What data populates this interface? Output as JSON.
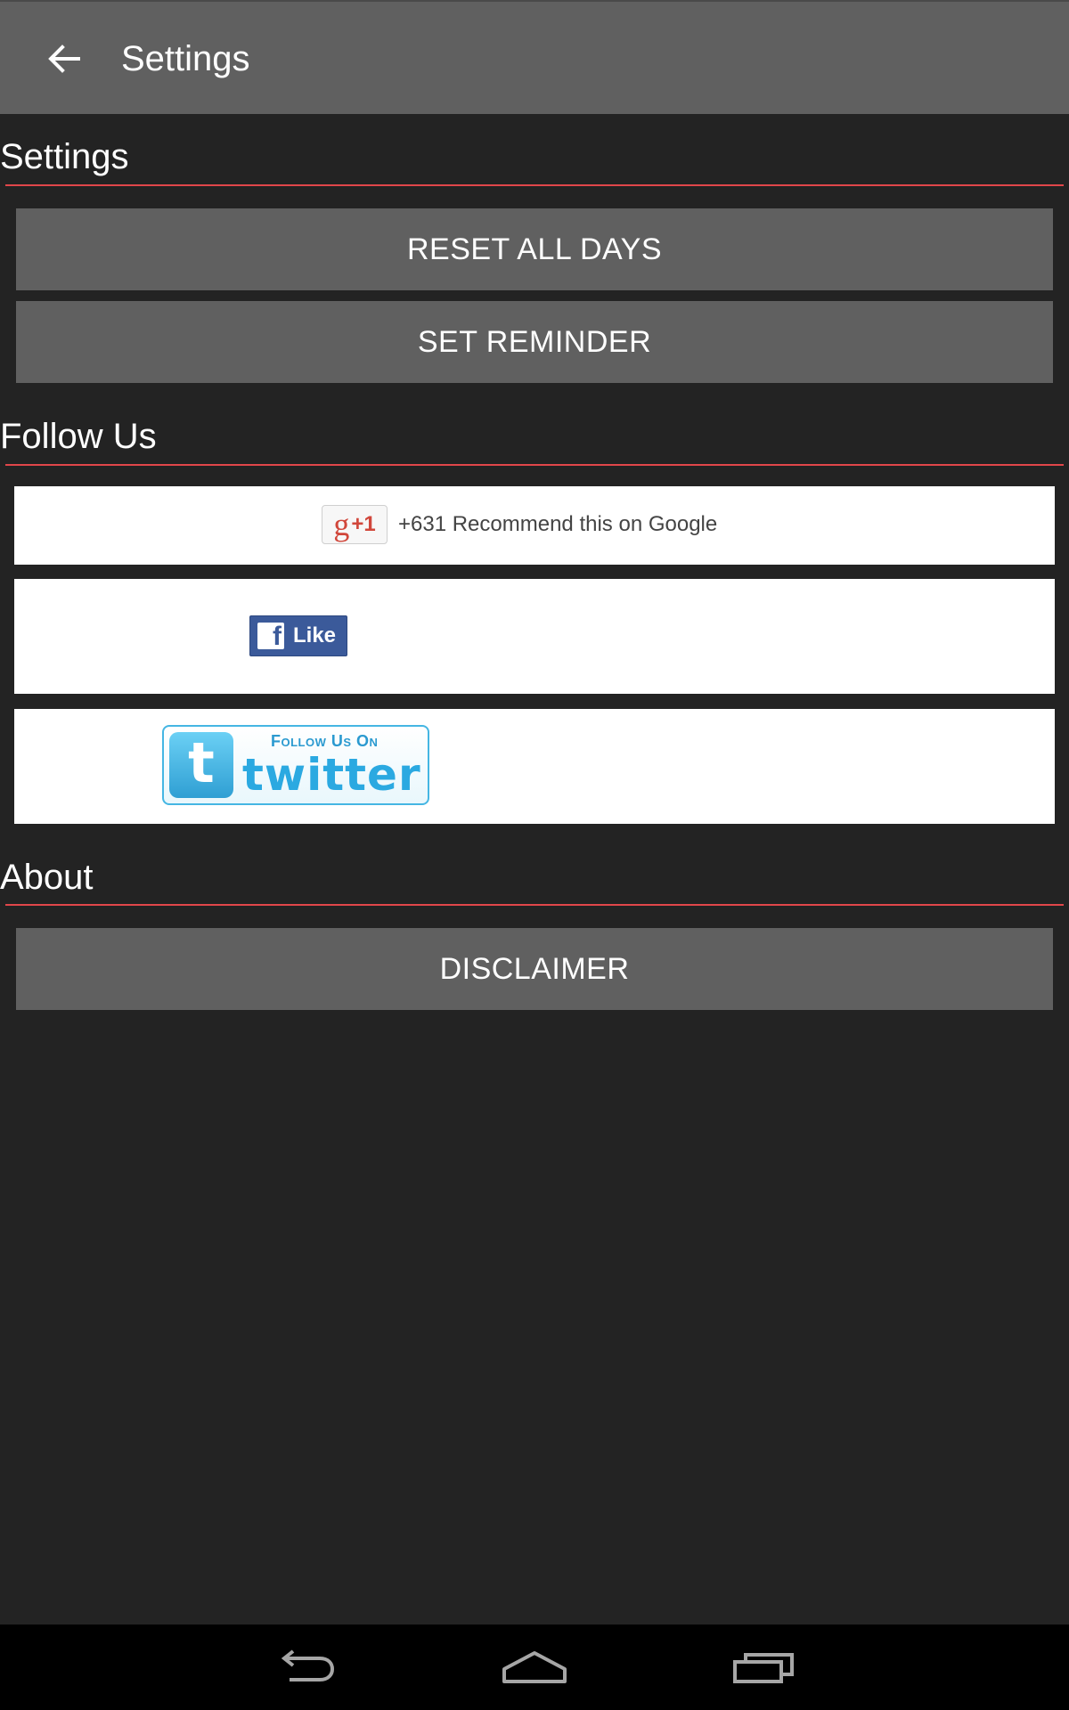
{
  "app_bar": {
    "title": "Settings",
    "back_icon": "arrow-back-icon"
  },
  "sections": {
    "settings": {
      "title": "Settings",
      "reset_label": "RESET ALL DAYS",
      "reminder_label": "SET REMINDER"
    },
    "follow": {
      "title": "Follow Us",
      "gplus_logo": "g+1",
      "gplus_text": "+631 Recommend this on Google",
      "facebook_label": "Like",
      "twitter_follow": "Follow Us On",
      "twitter_word": "twitter"
    },
    "about": {
      "title": "About",
      "disclaimer_label": "DISCLAIMER"
    }
  },
  "nav_bar": {
    "icons": [
      "back-icon",
      "home-icon",
      "recents-icon"
    ]
  },
  "colors": {
    "app_bar": "#606060",
    "background": "#232323",
    "accent_rule": "#e0464a",
    "button": "#606060"
  }
}
